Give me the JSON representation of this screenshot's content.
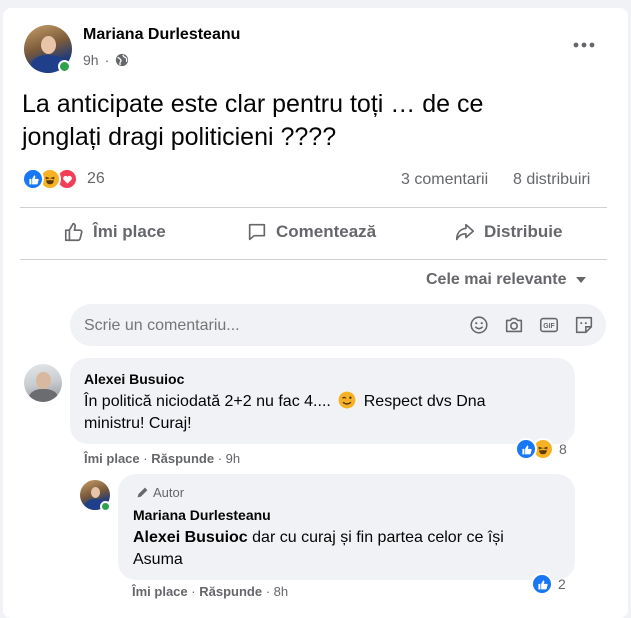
{
  "post": {
    "author": "Mariana Durlesteanu",
    "time": "9h",
    "text_line1": "La anticipate este clar pentru toți … de ce",
    "text_line2": "jonglați dragi politicieni ????",
    "reactions_count": "26",
    "comments_count": "3 comentarii",
    "shares_count": "8 distribuiri"
  },
  "actions": {
    "like": "Îmi place",
    "comment": "Comentează",
    "share": "Distribuie"
  },
  "sort": {
    "label": "Cele mai relevante"
  },
  "composer": {
    "placeholder": "Scrie un comentariu..."
  },
  "comments": [
    {
      "author": "Alexei Busuioc",
      "text_line1": "În politică niciodată 2+2 nu fac 4....",
      "text_line1_tail": "Respect dvs Dna",
      "text_line2": "ministru! Curaj!",
      "like": "Îmi place",
      "reply": "Răspunde",
      "time": "9h",
      "reactions": "8"
    }
  ],
  "reply": {
    "badge": "Autor",
    "author": "Mariana Durlesteanu",
    "mention": "Alexei Busuioc",
    "text_line1": "dar cu curaj și fin partea celor ce își",
    "text_line2": "Asuma",
    "like": "Îmi place",
    "reply": "Răspunde",
    "time": "8h",
    "reactions": "2"
  },
  "colors": {
    "accent": "#1877f2",
    "background": "#f0f2f5",
    "secondary_text": "#65676b",
    "online": "#31a24c"
  }
}
